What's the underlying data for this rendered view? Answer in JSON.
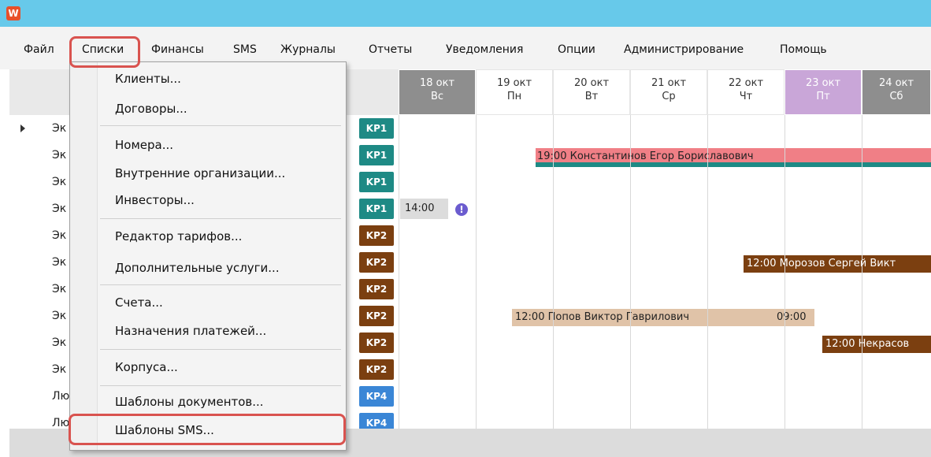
{
  "app": {
    "icon_label": "W",
    "icon_name": "app-logo-icon",
    "accent": "#67c9ea"
  },
  "menubar": {
    "items": [
      "Файл",
      "Списки",
      "Финансы",
      "SMS",
      "Журналы",
      "Отчеты",
      "Уведомления",
      "Опции",
      "Администрирование",
      "Помощь"
    ],
    "active": "Списки"
  },
  "dropdown": {
    "groups": [
      [
        "Клиенты...",
        "Договоры..."
      ],
      [
        "Номера...",
        "Внутренние организации...",
        "Инвесторы..."
      ],
      [
        "Редактор тарифов...",
        "Дополнительные услуги..."
      ],
      [
        "Счета...",
        "Назначения платежей..."
      ],
      [
        "Корпуса..."
      ],
      [
        "Шаблоны документов...",
        "Шаблоны SMS..."
      ]
    ],
    "highlighted": "Шаблоны SMS..."
  },
  "days": [
    {
      "date": "18 окт",
      "dow": "Вс",
      "color": "#8e8e8e"
    },
    {
      "date": "19 окт",
      "dow": "Пн",
      "color": ""
    },
    {
      "date": "20 окт",
      "dow": "Вт",
      "color": ""
    },
    {
      "date": "21 окт",
      "dow": "Ср",
      "color": ""
    },
    {
      "date": "22 окт",
      "dow": "Чт",
      "color": ""
    },
    {
      "date": "23 окт",
      "dow": "Пт",
      "color": "#c9a6d8"
    },
    {
      "date": "24 окт",
      "dow": "Сб",
      "color": "#8e8e8e"
    }
  ],
  "rows": [
    {
      "name": "Эк",
      "kp": "KP1",
      "kp_color": "#1e8a85",
      "selected": true
    },
    {
      "name": "Эк",
      "kp": "KP1",
      "kp_color": "#1e8a85",
      "selected": false
    },
    {
      "name": "Эк",
      "kp": "KP1",
      "kp_color": "#1e8a85",
      "selected": false
    },
    {
      "name": "Эк",
      "kp": "KP1",
      "kp_color": "#1e8a85",
      "selected": false
    },
    {
      "name": "Эк",
      "kp": "KP2",
      "kp_color": "#7b3f10",
      "selected": false
    },
    {
      "name": "Эк",
      "kp": "KP2",
      "kp_color": "#7b3f10",
      "selected": false
    },
    {
      "name": "Эк",
      "kp": "KP2",
      "kp_color": "#7b3f10",
      "selected": false
    },
    {
      "name": "Эк",
      "kp": "KP2",
      "kp_color": "#7b3f10",
      "selected": false
    },
    {
      "name": "Эк",
      "kp": "KP2",
      "kp_color": "#7b3f10",
      "selected": false
    },
    {
      "name": "Эк",
      "kp": "KP2",
      "kp_color": "#7b3f10",
      "selected": false
    },
    {
      "name": "Лю",
      "kp": "KP4",
      "kp_color": "#3a86d6",
      "selected": false
    },
    {
      "name": "Лю",
      "kp": "KP4",
      "kp_color": "#3a86d6",
      "selected": false
    }
  ],
  "bookings": [
    {
      "text": "19:00 Константинов Егор Бориславович",
      "color": "#f07f86"
    },
    {
      "text": "14:00",
      "color": "#dcdcdc"
    },
    {
      "text": "12:00 Морозов Сергей Викт",
      "color": "#7b3f10"
    },
    {
      "text": "12:00 Попов Виктор Гаврилович",
      "color": "#e0c3a8"
    },
    {
      "text": "09:00",
      "color": "#e0c3a8"
    },
    {
      "text": "12:00 Некрасов",
      "color": "#7b3f10"
    }
  ]
}
